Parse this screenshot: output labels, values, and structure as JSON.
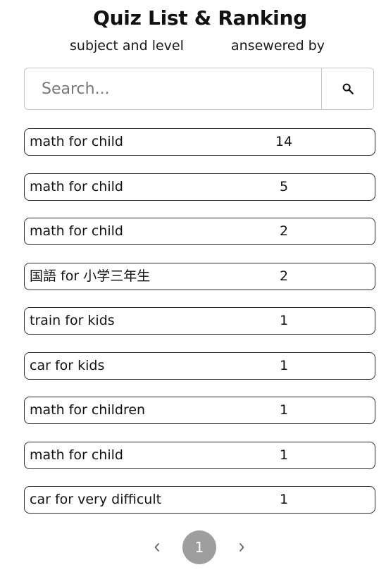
{
  "header": {
    "title": "Quiz List & Ranking",
    "subject_col": "subject and level",
    "answered_col": "ansewered by"
  },
  "search": {
    "placeholder": "Search...",
    "value": "",
    "button_icon": "search-icon"
  },
  "quizzes": [
    {
      "subject": "math for child",
      "count": "14"
    },
    {
      "subject": "math for child",
      "count": "5"
    },
    {
      "subject": "math for child",
      "count": "2"
    },
    {
      "subject": "国語 for 小学三年生",
      "count": "2"
    },
    {
      "subject": "train for kids",
      "count": "1"
    },
    {
      "subject": "car for kids",
      "count": "1"
    },
    {
      "subject": "math for children",
      "count": "1"
    },
    {
      "subject": "math for child",
      "count": "1"
    },
    {
      "subject": "car for very difficult",
      "count": "1"
    }
  ],
  "pagination": {
    "prev_icon": "chevron-left-icon",
    "current_page": "1",
    "next_icon": "chevron-right-icon"
  },
  "colors": {
    "page_active_bg": "#9e9e9e",
    "row_border": "#2b2b2b",
    "search_border": "#c4c4c4"
  }
}
